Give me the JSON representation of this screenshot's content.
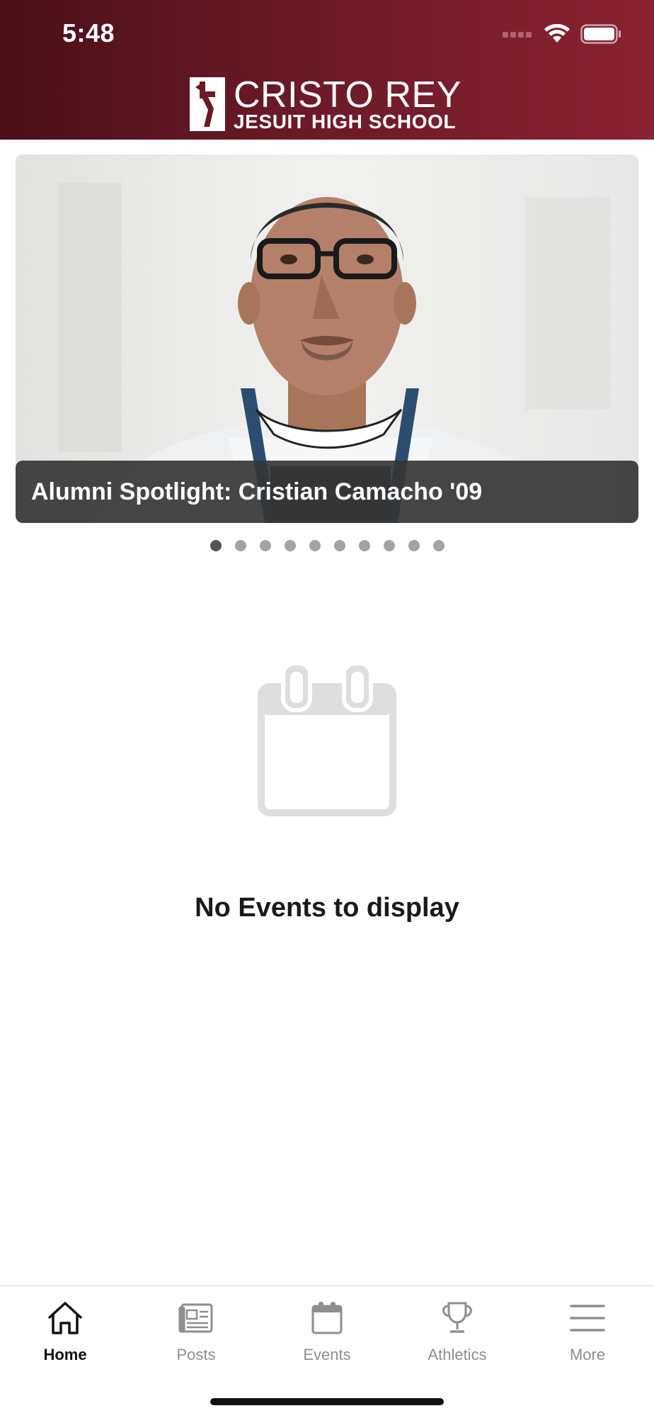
{
  "status_bar": {
    "time": "5:48"
  },
  "header": {
    "logo_line1": "CRISTO REY",
    "logo_line2": "JESUIT HIGH SCHOOL"
  },
  "carousel": {
    "caption": "Alumni Spotlight: Cristian Camacho '09",
    "page_count": 10,
    "active_index": 0
  },
  "events": {
    "empty_message": "No Events to display"
  },
  "tabbar": {
    "tabs": [
      {
        "label": "Home",
        "icon": "home-icon",
        "active": true
      },
      {
        "label": "Posts",
        "icon": "newspaper-icon",
        "active": false
      },
      {
        "label": "Events",
        "icon": "calendar-icon",
        "active": false
      },
      {
        "label": "Athletics",
        "icon": "trophy-icon",
        "active": false
      },
      {
        "label": "More",
        "icon": "menu-icon",
        "active": false
      }
    ]
  },
  "colors": {
    "header_dark": "#4a0f19",
    "header_light": "#8a2233",
    "active_tab": "#111111",
    "inactive_tab": "#8e8e8e"
  }
}
